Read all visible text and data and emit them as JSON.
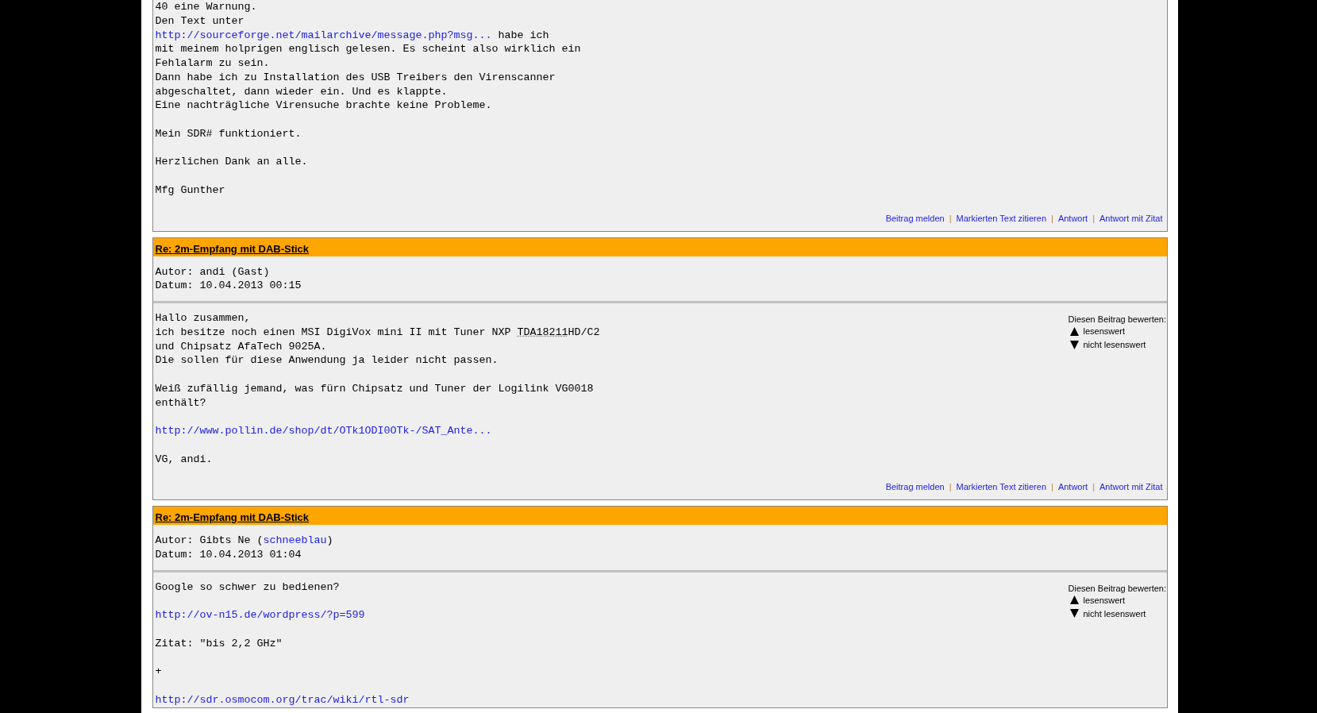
{
  "posts": [
    {
      "separator": "|",
      "body": [
        [
          [
            {
              "kind": "text",
              "text": "40 eine Warnung."
            }
          ],
          [
            {
              "kind": "text",
              "text": "Den Text unter"
            }
          ],
          [
            {
              "kind": "link",
              "text": "http://sourceforge.net/mailarchive/message.php?msg..."
            },
            {
              "kind": "text",
              "text": " habe ich"
            }
          ],
          [
            {
              "kind": "text",
              "text": "mit meinem holprigen englisch gelesen. Es scheint also wirklich ein"
            }
          ],
          [
            {
              "kind": "text",
              "text": "Fehlalarm zu sein."
            }
          ],
          [
            {
              "kind": "text",
              "text": "Dann habe ich zu Installation des USB Treibers den Virenscanner"
            }
          ],
          [
            {
              "kind": "text",
              "text": "abgeschaltet, dann wieder ein. Und es klappte."
            }
          ],
          [
            {
              "kind": "text",
              "text": "Eine nachträgliche Virensuche brachte keine Probleme."
            }
          ]
        ],
        [
          [
            {
              "kind": "text",
              "text": "Mein SDR# funktioniert."
            }
          ]
        ],
        [
          [
            {
              "kind": "text",
              "text": "Herzlichen Dank an alle."
            }
          ]
        ],
        [
          [
            {
              "kind": "text",
              "text": "Mfg Gunther"
            }
          ]
        ]
      ],
      "actions": [
        "Beitrag melden",
        "Markierten Text zitieren",
        "Antwort",
        "Antwort mit Zitat"
      ]
    },
    {
      "title": "Re: 2m-Empfang mit DAB-Stick",
      "separator": "|",
      "meta": [
        [
          {
            "kind": "text",
            "text": "Autor: andi (Gast)"
          }
        ],
        [
          {
            "kind": "text",
            "text": "Datum: 10.04.2013 00:15"
          }
        ]
      ],
      "rating": {
        "label": "Diesen Beitrag bewerten:",
        "up": "lesenswert",
        "down": "nicht lesenswert"
      },
      "body": [
        [
          [
            {
              "kind": "text",
              "text": "Hallo zusammen,"
            }
          ],
          [
            {
              "kind": "text",
              "text": "ich besitze noch einen MSI DigiVox mini II mit Tuner NXP "
            },
            {
              "kind": "abbr",
              "text": "TDA18211"
            },
            {
              "kind": "text",
              "text": "HD/C2"
            }
          ],
          [
            {
              "kind": "text",
              "text": "und Chipsatz AfaTech 9025A."
            }
          ],
          [
            {
              "kind": "text",
              "text": "Die sollen für diese Anwendung ja leider nicht passen."
            }
          ]
        ],
        [
          [
            {
              "kind": "text",
              "text": "Weiß zufällig jemand, was fürn Chipsatz und Tuner der Logilink VG0018"
            }
          ],
          [
            {
              "kind": "text",
              "text": "enthält?"
            }
          ]
        ],
        [
          [
            {
              "kind": "link",
              "text": "http://www.pollin.de/shop/dt/OTk1ODI0OTk-/SAT_Ante..."
            }
          ]
        ],
        [
          [
            {
              "kind": "text",
              "text": "VG, andi."
            }
          ]
        ]
      ],
      "actions": [
        "Beitrag melden",
        "Markierten Text zitieren",
        "Antwort",
        "Antwort mit Zitat"
      ]
    },
    {
      "title": "Re: 2m-Empfang mit DAB-Stick",
      "meta": [
        [
          {
            "kind": "text",
            "text": "Autor: Gibts Ne ("
          },
          {
            "kind": "link",
            "text": "schneeblau"
          },
          {
            "kind": "text",
            "text": ")"
          }
        ],
        [
          {
            "kind": "text",
            "text": "Datum: 10.04.2013 01:04"
          }
        ]
      ],
      "rating": {
        "label": "Diesen Beitrag bewerten:",
        "up": "lesenswert",
        "down": "nicht lesenswert"
      },
      "body": [
        [
          [
            {
              "kind": "text",
              "text": "Google so schwer zu bedienen?"
            }
          ]
        ],
        [
          [
            {
              "kind": "link",
              "text": "http://ov-n15.de/wordpress/?p=599"
            }
          ]
        ],
        [
          [
            {
              "kind": "text",
              "text": "Zitat: \"bis 2,2 GHz\""
            }
          ]
        ],
        [
          [
            {
              "kind": "text",
              "text": "+"
            }
          ]
        ],
        [
          [
            {
              "kind": "link",
              "text": "http://sdr.osmocom.org/trac/wiki/rtl-sdr"
            }
          ]
        ]
      ]
    }
  ]
}
